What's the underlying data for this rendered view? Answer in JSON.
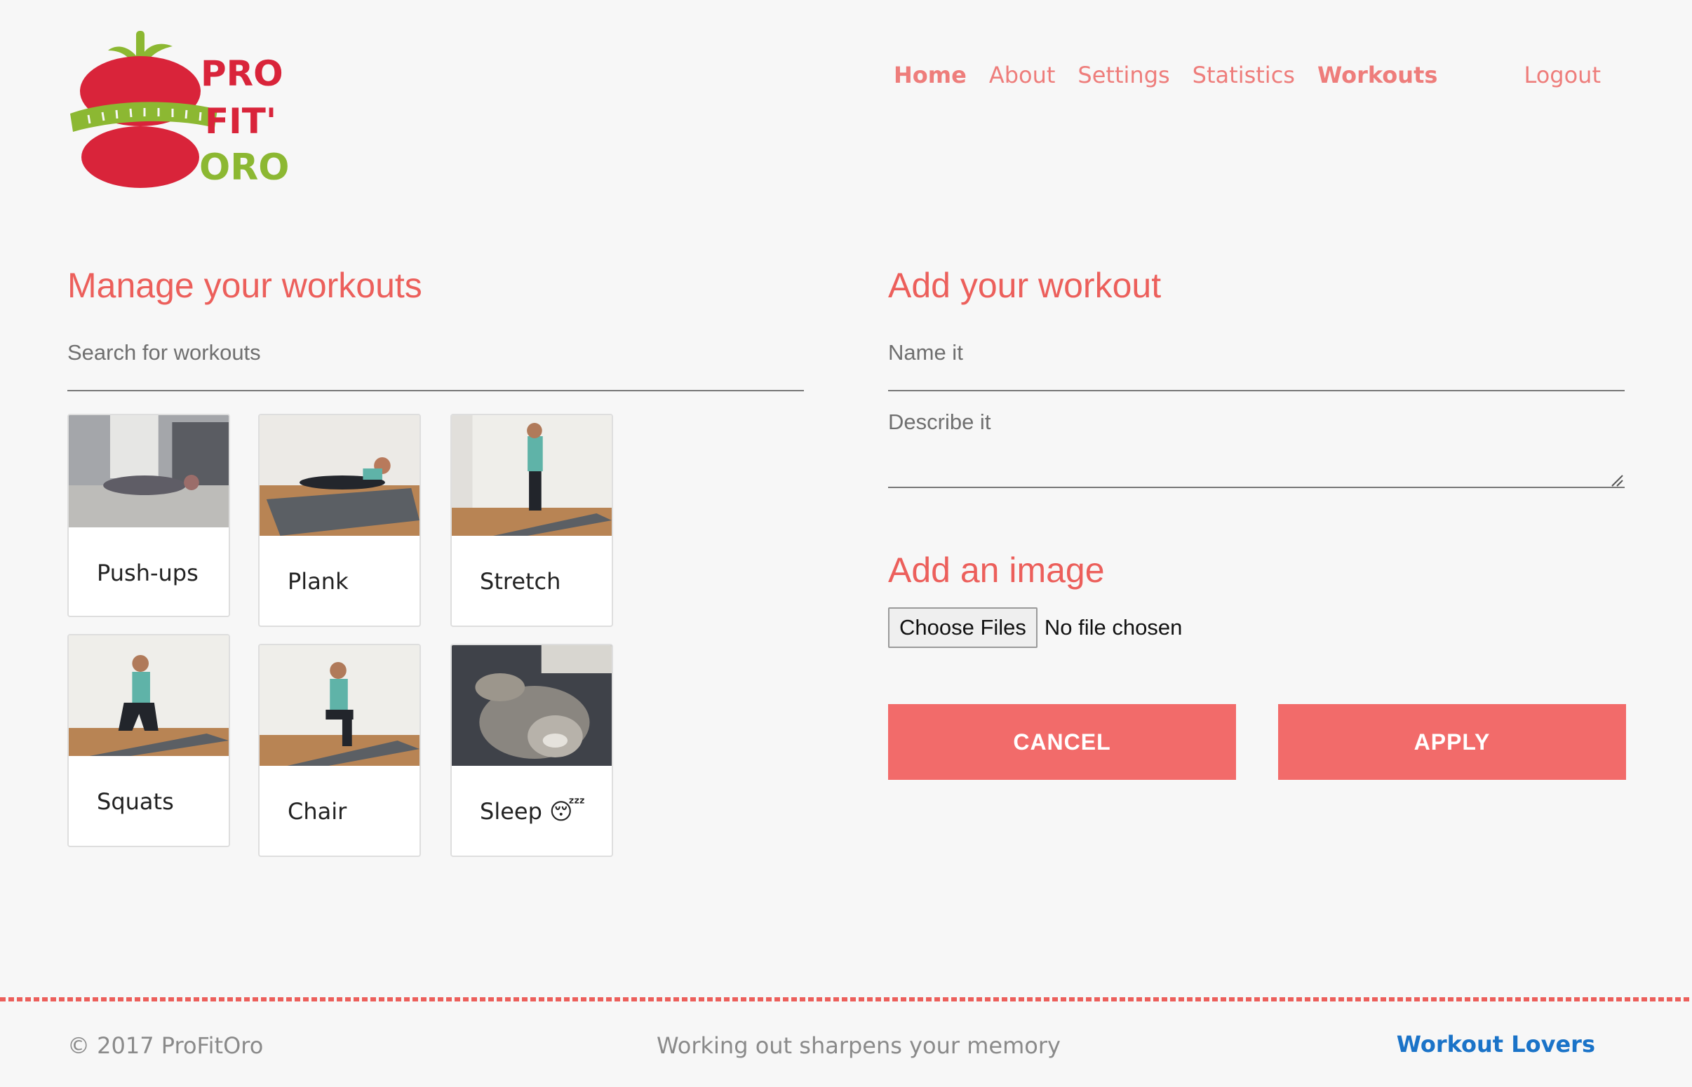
{
  "brand": {
    "name": "ProFitOro",
    "logo_text_lines": [
      "PRO",
      "FIT'",
      "ORO"
    ],
    "colors": {
      "red": "#d9243a",
      "green": "#8cb832",
      "accent": "#ec5f5b",
      "button": "#f26b6a",
      "link": "#1a73c8"
    }
  },
  "nav": {
    "items": [
      {
        "label": "Home",
        "bold": true
      },
      {
        "label": "About",
        "bold": false
      },
      {
        "label": "Settings",
        "bold": false
      },
      {
        "label": "Statistics",
        "bold": false
      },
      {
        "label": "Workouts",
        "bold": true
      }
    ],
    "logout": "Logout"
  },
  "manage": {
    "title": "Manage your workouts",
    "search_placeholder": "Search for workouts",
    "workouts": [
      {
        "label": "Push-ups",
        "icon": "push-ups-photo"
      },
      {
        "label": "Plank",
        "icon": "plank-photo"
      },
      {
        "label": "Stretch",
        "icon": "stretch-photo"
      },
      {
        "label": "Squats",
        "icon": "squats-photo"
      },
      {
        "label": "Chair",
        "icon": "chair-photo"
      },
      {
        "label": "Sleep 😴",
        "icon": "sleeping-cat-photo"
      }
    ]
  },
  "add": {
    "title": "Add your workout",
    "name_placeholder": "Name it",
    "describe_placeholder": "Describe it",
    "image_title": "Add an image",
    "choose_files": "Choose Files",
    "file_status": "No file chosen",
    "cancel": "CANCEL",
    "apply": "APPLY"
  },
  "footer": {
    "copyright": "© 2017 ProFitOro",
    "tagline": "Working out sharpens your memory",
    "link": "Workout Lovers"
  }
}
